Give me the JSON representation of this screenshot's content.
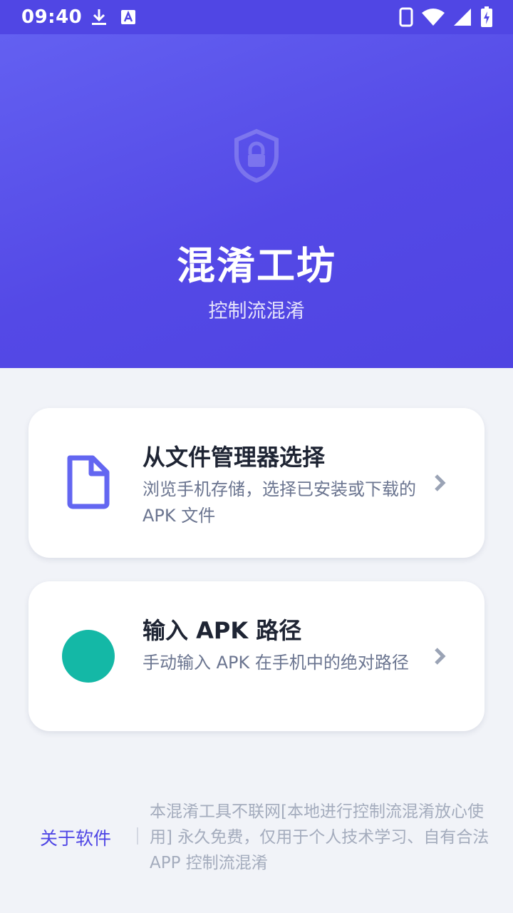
{
  "status_bar": {
    "time": "09:40",
    "icons": [
      "download-icon",
      "text-a-icon",
      "phone-icon",
      "wifi-icon",
      "signal-icon",
      "battery-charging-icon"
    ]
  },
  "hero": {
    "icon": "shield-lock-icon",
    "title": "混淆工坊",
    "subtitle": "控制流混淆"
  },
  "options": [
    {
      "icon": "file-icon",
      "title": "从文件管理器选择",
      "description": "浏览手机存储，选择已安装或下载的 APK 文件"
    },
    {
      "icon": "circle-icon",
      "title": "输入 APK 路径",
      "description": "手动输入 APK 在手机中的绝对路径"
    }
  ],
  "footer": {
    "about_label": "关于软件",
    "note": "本混淆工具不联网[本地进行控制流混淆放心使用] 永久免费，仅用于个人技术学习、自有合法 APP 控制流混淆"
  },
  "colors": {
    "primary": "#4f46e5",
    "hero_gradient_start": "#6360f1",
    "hero_gradient_end": "#4f44e2",
    "accent_teal": "#14b8a6",
    "file_icon": "#6366f1",
    "background": "#f1f3f8"
  }
}
